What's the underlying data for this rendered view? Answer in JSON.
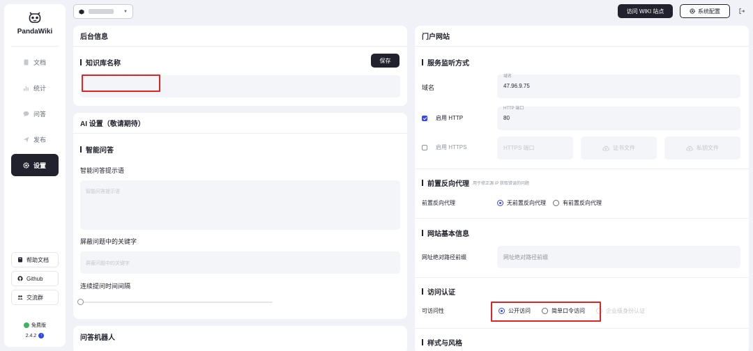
{
  "sidebar": {
    "brand": "PandaWiki",
    "nav": [
      {
        "label": "文档",
        "icon": "document-icon"
      },
      {
        "label": "统计",
        "icon": "bar-chart-icon"
      },
      {
        "label": "问答",
        "icon": "chat-icon"
      },
      {
        "label": "发布",
        "icon": "send-icon"
      },
      {
        "label": "设置",
        "icon": "gear-icon",
        "active": true
      }
    ],
    "bottom": [
      {
        "label": "帮助文档",
        "icon": "book-icon"
      },
      {
        "label": "Github",
        "icon": "github-icon"
      },
      {
        "label": "交流群",
        "icon": "group-icon"
      }
    ],
    "plan": "免费版",
    "version": "2.4.2"
  },
  "header": {
    "visit_label": "访问 WIKI 站点",
    "settings_label": "系统配置"
  },
  "backend": {
    "title": "后台信息",
    "kb_name_title": "知识库名称",
    "save_label": "保存"
  },
  "ai": {
    "title": "AI 设置（敬请期待）",
    "qa_title": "智能问答",
    "prompt_label": "智能问答提示语",
    "prompt_placeholder": "智能问答提示语",
    "block_label": "屏蔽问题中的关键字",
    "block_placeholder": "屏蔽问题中的关键字",
    "interval_label": "连续提问时间间隔",
    "interval_value": 0
  },
  "bot": {
    "title": "问答机器人"
  },
  "portal": {
    "title": "门户网站",
    "listen_title": "服务监听方式",
    "domain_label": "域名",
    "domain_field_caption": "域名",
    "domain_value": "47.96.9.75",
    "http_label": "启用 HTTP",
    "http_checked": true,
    "http_port_caption": "HTTP 端口",
    "http_port_value": "80",
    "https_label": "启用 HTTPS",
    "https_checked": false,
    "https_port_placeholder": "HTTPS 端口",
    "cert_label": "证书文件",
    "key_label": "私钥文件",
    "proxy_title": "前置反向代理",
    "proxy_sub": "用于修正源 IP 获取错误的问题",
    "proxy_label": "前置反向代理",
    "proxy_options": [
      "无前置反向代理",
      "有前置反向代理"
    ],
    "proxy_selected": 0,
    "basic_title": "网站基本信息",
    "path_label": "网址绝对路径前缀",
    "path_placeholder": "网址绝对路径前缀",
    "auth_title": "访问认证",
    "access_label": "可访问性",
    "access_options": [
      "公开访问",
      "简单口令访问",
      "企业级身份认证"
    ],
    "access_selected": 0,
    "style_title": "样式与风格"
  },
  "colors": {
    "accent": "#3248f2",
    "dark": "#21222d",
    "highlight": "#e02424",
    "success": "#3fb35e"
  }
}
